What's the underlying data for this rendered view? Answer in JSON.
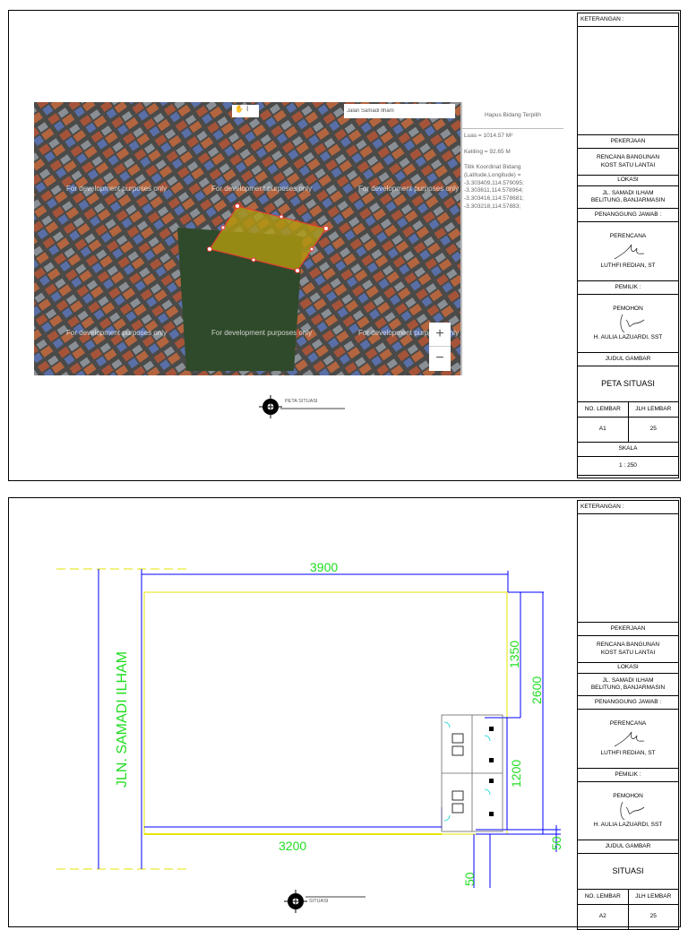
{
  "sheets": [
    {
      "title_block": {
        "keterangan": "KETERANGAN :",
        "pekerjaan_label": "PEKERJAAN",
        "pekerjaan_1": "RENCANA BANGUNAN",
        "pekerjaan_2": "KOST SATU LANTAI",
        "lokasi_label": "LOKASI",
        "lokasi_1": "JL. SAMADI ILHAM",
        "lokasi_2": "BELITUNG, BANJARMASIN",
        "penanggung_label": "PENANGGUNG JAWAB :",
        "perencana_label": "PERENCANA",
        "perencana_name": "LUTHFI REDIAN, ST",
        "pemilik_label": "PEMILIK :",
        "pemohon_label": "PEMOHON",
        "pemohon_name": "H. AULIA LAZUARDI, SST",
        "judul_label": "JUDUL GAMBAR",
        "judul": "PETA SITUASI",
        "no_lembar_label": "NO. LEMBAR",
        "jlh_lembar_label": "JLH LEMBAR",
        "no_lembar": "A1",
        "jlh_lembar": "25",
        "skala_label": "SKALA",
        "skala": "1 : 250"
      }
    },
    {
      "title_block": {
        "keterangan": "KETERANGAN :",
        "pekerjaan_label": "PEKERJAAN",
        "pekerjaan_1": "RENCANA BANGUNAN",
        "pekerjaan_2": "KOST SATU LANTAI",
        "lokasi_label": "LOKASI",
        "lokasi_1": "JL. SAMADI ILHAM",
        "lokasi_2": "BELITUNG, BANJARMASIN",
        "penanggung_label": "PENANGGUNG JAWAB :",
        "perencana_label": "PERENCANA",
        "perencana_name": "LUTHFI REDIAN, ST",
        "pemilik_label": "PEMILIK :",
        "pemohon_label": "PEMOHON",
        "pemohon_name": "H. AULIA LAZUARDI, SST",
        "judul_label": "JUDUL GAMBAR",
        "judul": "SITUASI",
        "no_lembar_label": "NO. LEMBAR",
        "jlh_lembar_label": "JLH LEMBAR",
        "no_lembar": "A2",
        "jlh_lembar": "25"
      }
    }
  ],
  "map": {
    "search_value": "Jalan Samadi Ilham",
    "watermark": "For development purposes only",
    "delete_button": "Hapus Bidang Terpilih",
    "luas": "Luas = 1014.57 M²",
    "keliling": "Keliling = 92.65 M",
    "coord_title": "Titik Koordinat Bidang",
    "coord_format": "(Latitude,Longitude) =",
    "coords": [
      "-3.303409,114.579095;",
      "-3.303611,114.578964;",
      "-3.303416,114.578681;",
      "-3.303218,114.57883;"
    ],
    "zoom_in": "+",
    "zoom_out": "−",
    "polygon_color": "#c8a800"
  },
  "sheet1": {
    "north_label": "PETA SITUASI"
  },
  "sheet2": {
    "road_label": "JLN. SAMADI ILHAM",
    "dims": [
      "3900",
      "3200",
      "1350",
      "2600",
      "1200",
      "50",
      "50"
    ],
    "north_label": "SITUASI"
  }
}
